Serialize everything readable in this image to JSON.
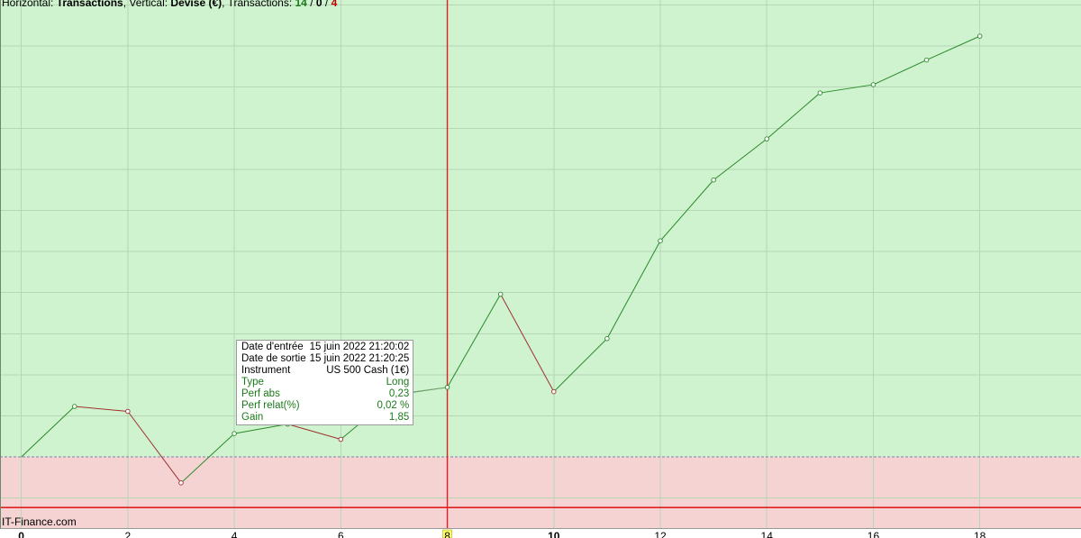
{
  "header": {
    "h_prefix": "Horizontal: ",
    "h_value": "Transactions",
    "v_prefix": ", Vertical: ",
    "v_value": "Devise (€)",
    "t_prefix": ", Transactions: ",
    "wins": "14",
    "sep1": " / ",
    "even": "0",
    "sep2": " / ",
    "losses": "4"
  },
  "watermark": "IT-Finance.com",
  "tooltip": {
    "rows": [
      {
        "label": "Date d'entrée",
        "value": "15 juin 2022 21:20:02"
      },
      {
        "label": "Date de sortie",
        "value": "15 juin 2022 21:20:25"
      },
      {
        "label": "Instrument",
        "value": "US 500 Cash (1€)"
      },
      {
        "label": "Type",
        "value": "Long"
      },
      {
        "label": "Perf abs",
        "value": "0,23"
      },
      {
        "label": "Perf relat(%)",
        "value": "0,02 %"
      },
      {
        "label": "Gain",
        "value": "1,85"
      }
    ]
  },
  "colors": {
    "profit_zone": "#cff3cf",
    "loss_zone": "#f5d3d3",
    "gain_line": "#2a8a2a",
    "loss_line": "#a03030",
    "cursor": "#e02020",
    "highlight": "#ffff66"
  },
  "chart_data": {
    "type": "line",
    "x": [
      0,
      1,
      2,
      3,
      4,
      5,
      6,
      7,
      8,
      9,
      10,
      11,
      12,
      13,
      14,
      15,
      16,
      17,
      18
    ],
    "y": [
      0,
      12.3,
      11.1,
      -6.3,
      5.7,
      8.0,
      4.3,
      15.1,
      16.95,
      39.6,
      15.9,
      28.8,
      52.6,
      67.4,
      77.4,
      88.6,
      90.6,
      96.6,
      102.4
    ],
    "xticks": [
      0,
      2,
      4,
      6,
      8,
      10,
      12,
      14,
      16,
      18
    ],
    "bold_xticks": [
      0,
      10
    ],
    "cursor_x": 8,
    "xlim": [
      -0.4,
      19.9
    ],
    "ylim": [
      -17.3,
      111.2
    ],
    "floor_y": -12.3,
    "title": "",
    "xlabel": "",
    "ylabel": ""
  }
}
